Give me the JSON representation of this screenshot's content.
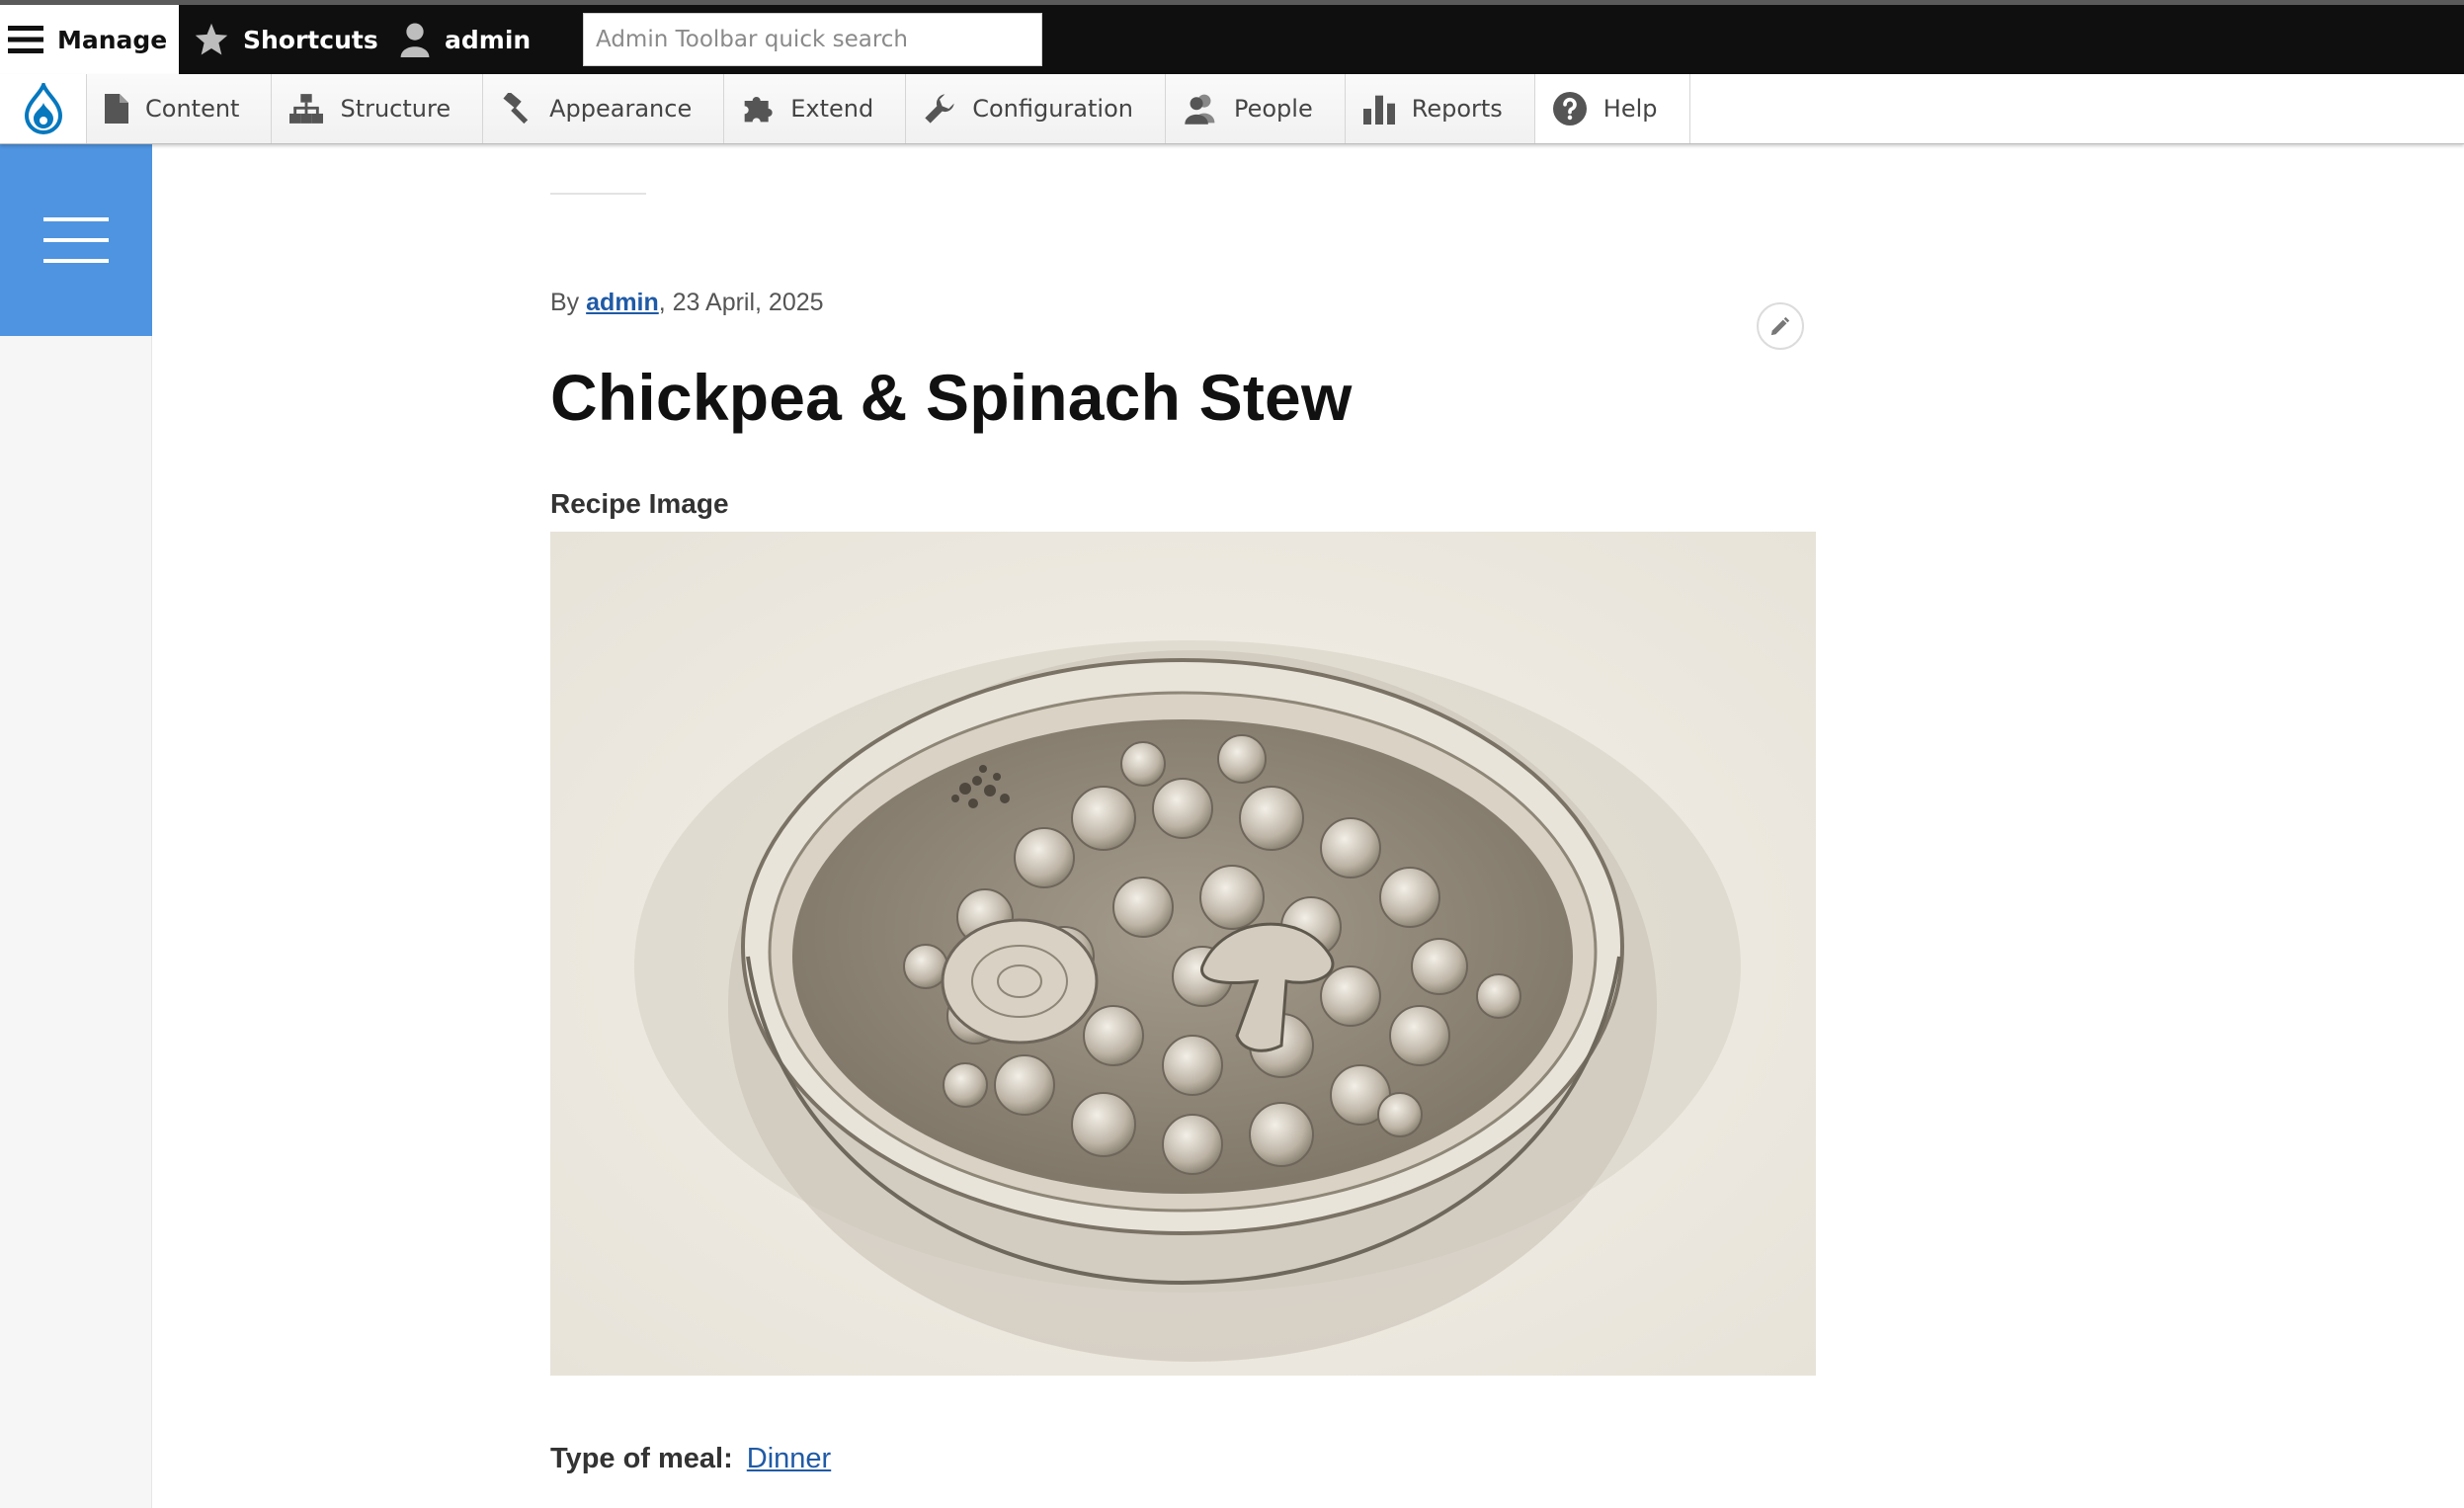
{
  "toolbar": {
    "manage_label": "Manage",
    "shortcuts_label": "Shortcuts",
    "user_label": "admin",
    "search_placeholder": "Admin Toolbar quick search"
  },
  "tray": {
    "items": [
      {
        "label": "Content",
        "icon": "file-icon"
      },
      {
        "label": "Structure",
        "icon": "sitemap-icon"
      },
      {
        "label": "Appearance",
        "icon": "paintbrush-icon"
      },
      {
        "label": "Extend",
        "icon": "puzzle-icon"
      },
      {
        "label": "Configuration",
        "icon": "wrench-icon"
      },
      {
        "label": "People",
        "icon": "people-icon"
      },
      {
        "label": "Reports",
        "icon": "bar-chart-icon"
      },
      {
        "label": "Help",
        "icon": "help-icon"
      }
    ]
  },
  "node": {
    "by_prefix": "By",
    "author": "admin",
    "date": ", 23 April, 2025",
    "title": "Chickpea & Spinach Stew",
    "image_label": "Recipe Image",
    "meal_label": "Type of meal:",
    "meal_value": "Dinner"
  },
  "colors": {
    "toolbar_bg": "#0f0f0f",
    "sidebar_accent": "#4e94e0",
    "link": "#1f5aa6",
    "drupal_blue": "#0678be"
  }
}
